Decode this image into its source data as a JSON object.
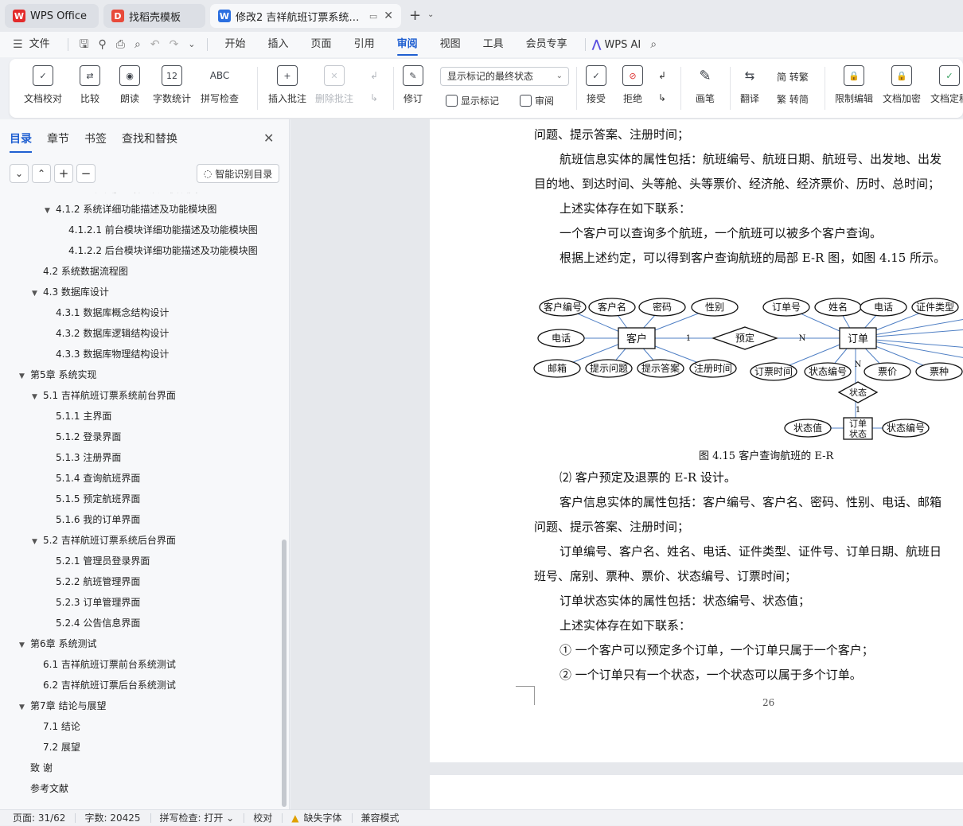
{
  "tabs": [
    {
      "label": "WPS Office",
      "icon": "W"
    },
    {
      "label": "找稻壳模板",
      "icon": "D"
    },
    {
      "label": "修改2 吉祥航班订票系统的设计",
      "icon": "W"
    }
  ],
  "menu": {
    "file": "文件",
    "items": [
      "开始",
      "插入",
      "页面",
      "引用",
      "审阅",
      "视图",
      "工具",
      "会员专享"
    ],
    "selected": "审阅",
    "wps_ai": "WPS AI"
  },
  "ribbon": {
    "doc_check": "文档校对",
    "compare": "比较",
    "read_aloud": "朗读",
    "word_count": "字数统计",
    "spell_check": "拼写检查",
    "insert_comment": "插入批注",
    "delete_comment": "删除批注",
    "revise": "修订",
    "markup_dropdown": "显示标记的最终状态",
    "show_markup": "显示标记",
    "review": "审阅",
    "accept": "接受",
    "reject": "拒绝",
    "pen": "画笔",
    "translate": "翻译",
    "to_traditional": "简 转繁",
    "to_simplified": "繁 转简",
    "restrict_edit": "限制编辑",
    "doc_encrypt": "文档加密",
    "doc_finalize": "文档定稿",
    "word_count_glyph": "12",
    "spell_glyph": "ABC"
  },
  "sidebar": {
    "tabs": [
      "目录",
      "章节",
      "书签",
      "查找和替换"
    ],
    "smart_btn": "智能识别目录",
    "toc": [
      {
        "text": "4.1.1  系统功能总描述及总模块图",
        "level": 3
      },
      {
        "text": "4.1.2  系统详细功能描述及功能模块图",
        "level": 3,
        "caret": "▼"
      },
      {
        "text": "4.1.2.1  前台模块详细功能描述及功能模块图",
        "level": 4
      },
      {
        "text": "4.1.2.2  后台模块详细功能描述及功能模块图",
        "level": 4
      },
      {
        "text": "4.2  系统数据流程图",
        "level": 2
      },
      {
        "text": "4.3  数据库设计",
        "level": 2,
        "caret": "▼"
      },
      {
        "text": "4.3.1 数据库概念结构设计",
        "level": 3
      },
      {
        "text": "4.3.2  数据库逻辑结构设计",
        "level": 3
      },
      {
        "text": "4.3.3  数据库物理结构设计",
        "level": 3
      },
      {
        "text": "第5章  系统实现",
        "level": 1,
        "caret": "▼"
      },
      {
        "text": "5.1  吉祥航班订票系统前台界面",
        "level": 2,
        "caret": "▼"
      },
      {
        "text": "5.1.1  主界面",
        "level": 3
      },
      {
        "text": "5.1.2  登录界面",
        "level": 3
      },
      {
        "text": "5.1.3  注册界面",
        "level": 3
      },
      {
        "text": "5.1.4  查询航班界面",
        "level": 3
      },
      {
        "text": "5.1.5  预定航班界面",
        "level": 3
      },
      {
        "text": "5.1.6  我的订单界面",
        "level": 3
      },
      {
        "text": "5.2  吉祥航班订票系统后台界面",
        "level": 2,
        "caret": "▼"
      },
      {
        "text": "5.2.1  管理员登录界面",
        "level": 3
      },
      {
        "text": "5.2.2  航班管理界面",
        "level": 3
      },
      {
        "text": "5.2.3  订单管理界面",
        "level": 3
      },
      {
        "text": "5.2.4 公告信息界面",
        "level": 3
      },
      {
        "text": "第6章  系统测试",
        "level": 1,
        "caret": "▼"
      },
      {
        "text": "6.1  吉祥航班订票前台系统测试",
        "level": 2
      },
      {
        "text": "6.2  吉祥航班订票后台系统测试",
        "level": 2
      },
      {
        "text": "第7章  结论与展望",
        "level": 1,
        "caret": "▼"
      },
      {
        "text": "7.1  结论",
        "level": 2
      },
      {
        "text": "7.2  展望",
        "level": 2
      },
      {
        "text": "致   谢",
        "level": 1
      },
      {
        "text": "参考文献",
        "level": 1
      }
    ]
  },
  "document": {
    "lines": [
      {
        "text": "问题、提示答案、注册时间；",
        "indent": false
      },
      {
        "text": "航班信息实体的属性包括：航班编号、航班日期、航班号、出发地、出发",
        "indent": true
      },
      {
        "text": "目的地、到达时间、头等舱、头等票价、经济舱、经济票价、历时、总时间；",
        "indent": false
      },
      {
        "text": "上述实体存在如下联系：",
        "indent": true
      },
      {
        "text": "一个客户可以查询多个航班，一个航班可以被多个客户查询。",
        "indent": true
      },
      {
        "text": "根据上述约定，可以得到客户查询航班的局部 E-R 图，如图 4.15 所示。",
        "indent": true
      }
    ],
    "figure_caption": "图 4.15  客户查询航班的 E-R",
    "lines2": [
      {
        "text": "⑵  客户预定及退票的 E-R 设计。",
        "indent": true
      },
      {
        "text": "客户信息实体的属性包括：客户编号、客户名、密码、性别、电话、邮箱",
        "indent": true
      },
      {
        "text": "问题、提示答案、注册时间；",
        "indent": false
      },
      {
        "text": "订单编号、客户名、姓名、电话、证件类型、证件号、订单日期、航班日",
        "indent": true
      },
      {
        "text": "班号、席别、票种、票价、状态编号、订票时间；",
        "indent": false
      },
      {
        "text": "订单状态实体的属性包括：状态编号、状态值；",
        "indent": true
      },
      {
        "text": "上述实体存在如下联系：",
        "indent": true
      },
      {
        "text": "①  一个客户可以预定多个订单，一个订单只属于一个客户；",
        "indent": true
      },
      {
        "text": "②  一个订单只有一个状态，一个状态可以属于多个订单。",
        "indent": true
      }
    ],
    "page_number": "26"
  },
  "er": {
    "customer": "客户",
    "order": "订单",
    "reserve": "预定",
    "status_rel": "状态",
    "order_status": "订单\n状态",
    "card_1": "1",
    "card_n": "N",
    "card_n2": "N",
    "card_1b": "1",
    "cust_attrs": [
      "客户编号",
      "客户名",
      "密码",
      "性别",
      "电话",
      "邮箱",
      "提示问题",
      "提示答案",
      "注册时间"
    ],
    "order_attrs": [
      "订单号",
      "姓名",
      "电话",
      "证件类型",
      "订票时间",
      "状态编号",
      "票价",
      "票种"
    ],
    "status_attrs": [
      "状态值",
      "状态编号"
    ]
  },
  "status": {
    "page": "页面: 31/62",
    "words": "字数: 20425",
    "spell": "拼写检查: 打开 ⌄",
    "proof": "校对",
    "missing_font": "缺失字体",
    "compat": "兼容模式"
  },
  "colors": {
    "accent": "#1f5fd1",
    "er_line": "#4f7fc4"
  }
}
